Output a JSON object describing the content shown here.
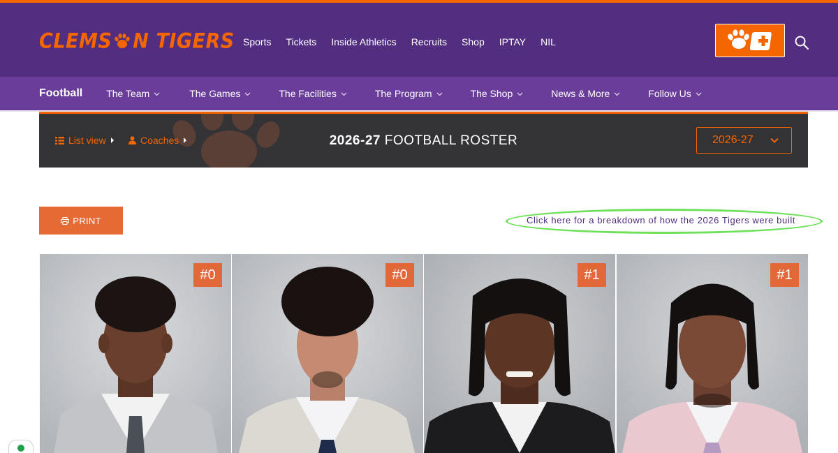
{
  "site": {
    "logo_text_left": "CLEMS",
    "logo_text_right": "N",
    "logo_text_second": "TIGERS"
  },
  "main_nav": [
    "Sports",
    "Tickets",
    "Inside Athletics",
    "Recruits",
    "Shop",
    "IPTAY",
    "NIL"
  ],
  "sub_nav": {
    "sport": "Football",
    "items": [
      "The Team",
      "The Games",
      "The Facilities",
      "The Program",
      "The Shop",
      "News & More",
      "Follow Us"
    ]
  },
  "banner": {
    "list_view": "List view",
    "coaches": "Coaches",
    "title_bold": "2026-27",
    "title_rest": " FOOTBALL ROSTER",
    "season": "2026-27"
  },
  "actions": {
    "print": "PRINT",
    "breakdown": "Click here for a breakdown of how the 2026 Tigers were built"
  },
  "players": [
    {
      "number": "#0"
    },
    {
      "number": "#0"
    },
    {
      "number": "#1"
    },
    {
      "number": "#1"
    }
  ],
  "colors": {
    "purple": "#522d80",
    "subnav_purple": "#6a3d9a",
    "orange": "#f56600",
    "banner_dark": "#333235",
    "highlight_green": "#6ee05a"
  }
}
